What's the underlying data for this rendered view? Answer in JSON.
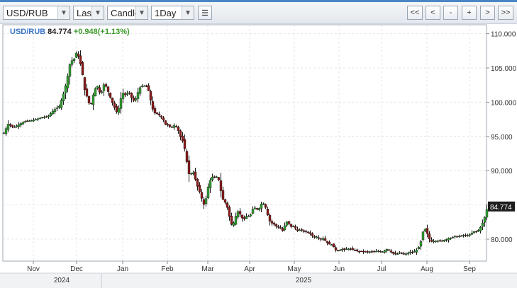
{
  "toolbar": {
    "symbol": "USD/RUB",
    "price_field": "Last",
    "chart_style": "Candle",
    "interval": "1Day",
    "buttons": [
      "<<",
      "<",
      "-",
      "+",
      ">",
      ">>"
    ],
    "menu_icon": "list-icon"
  },
  "legend": {
    "symbol": "USD/RUB",
    "last": "84.774",
    "change": "+0.948(+1.13%)"
  },
  "colors": {
    "up": "#2e9e2e",
    "down": "#8b1a1a",
    "grid": "#e4e4e4",
    "accent": "#4a86c5"
  },
  "chart_data": {
    "type": "candlestick",
    "title": "USD/RUB",
    "price_tag": "84.774",
    "y_ticks": [
      "80.000",
      "85.000",
      "90.000",
      "95.000",
      "100.000",
      "105.000",
      "110.000"
    ],
    "ylim": [
      76.8,
      111.3
    ],
    "x_ticks": [
      "Nov",
      "Dec",
      "Jan",
      "Feb",
      "Mar",
      "Apr",
      "May",
      "Jun",
      "Jul",
      "Aug",
      "Sep"
    ],
    "year_labels": [
      "2024",
      "2025"
    ],
    "grid": true,
    "close_path": [
      [
        0,
        95.5
      ],
      [
        6,
        96.8
      ],
      [
        14,
        96.3
      ],
      [
        22,
        96.8
      ],
      [
        30,
        97.2
      ],
      [
        38,
        97.3
      ],
      [
        46,
        97.5
      ],
      [
        54,
        97.8
      ],
      [
        62,
        97.9
      ],
      [
        70,
        98.8
      ],
      [
        78,
        99.4
      ],
      [
        84,
        101.2
      ],
      [
        88,
        102.8
      ],
      [
        92,
        104.8
      ],
      [
        94,
        106.2
      ],
      [
        97,
        106.0
      ],
      [
        100,
        106.5
      ],
      [
        103,
        107.5
      ],
      [
        106,
        106.3
      ],
      [
        109,
        105.2
      ],
      [
        112,
        103.4
      ],
      [
        115,
        101.0
      ],
      [
        118,
        100.8
      ],
      [
        121,
        99.4
      ],
      [
        124,
        100.0
      ],
      [
        127,
        101.6
      ],
      [
        130,
        102.2
      ],
      [
        133,
        102.4
      ],
      [
        136,
        101.0
      ],
      [
        139,
        101.8
      ],
      [
        142,
        102.9
      ],
      [
        145,
        102.0
      ],
      [
        148,
        101.3
      ],
      [
        151,
        100.4
      ],
      [
        154,
        99.7
      ],
      [
        157,
        99.0
      ],
      [
        160,
        98.4
      ],
      [
        163,
        99.4
      ],
      [
        166,
        101.1
      ],
      [
        169,
        101.4
      ],
      [
        172,
        100.9
      ],
      [
        175,
        101.5
      ],
      [
        178,
        101.3
      ],
      [
        181,
        100.3
      ],
      [
        184,
        100.2
      ],
      [
        187,
        100.7
      ],
      [
        190,
        101.8
      ],
      [
        193,
        102.3
      ],
      [
        196,
        102.4
      ],
      [
        199,
        102.4
      ],
      [
        202,
        102.2
      ],
      [
        205,
        101.4
      ],
      [
        208,
        99.7
      ],
      [
        211,
        98.6
      ],
      [
        214,
        98.3
      ],
      [
        217,
        98.3
      ],
      [
        220,
        98.0
      ],
      [
        223,
        97.7
      ],
      [
        226,
        97.2
      ],
      [
        229,
        96.5
      ],
      [
        232,
        96.7
      ],
      [
        235,
        96.3
      ],
      [
        238,
        96.4
      ],
      [
        241,
        96.7
      ],
      [
        244,
        96.3
      ],
      [
        247,
        95.6
      ],
      [
        250,
        94.6
      ],
      [
        253,
        94.2
      ],
      [
        256,
        92.7
      ],
      [
        259,
        90.6
      ],
      [
        262,
        89.0
      ],
      [
        265,
        89.9
      ],
      [
        268,
        89.6
      ],
      [
        271,
        88.3
      ],
      [
        274,
        87.4
      ],
      [
        277,
        86.7
      ],
      [
        280,
        85.6
      ],
      [
        283,
        84.8
      ],
      [
        286,
        86.5
      ],
      [
        289,
        88.2
      ],
      [
        292,
        88.8
      ],
      [
        295,
        89.2
      ],
      [
        298,
        88.9
      ],
      [
        301,
        89.2
      ],
      [
        304,
        88.4
      ],
      [
        307,
        86.4
      ],
      [
        310,
        85.5
      ],
      [
        313,
        85.3
      ],
      [
        316,
        84.3
      ],
      [
        319,
        82.8
      ],
      [
        322,
        81.8
      ],
      [
        325,
        82.7
      ],
      [
        328,
        83.7
      ],
      [
        331,
        84.2
      ],
      [
        334,
        83.4
      ],
      [
        337,
        82.9
      ],
      [
        340,
        83.0
      ],
      [
        343,
        83.5
      ],
      [
        346,
        83.3
      ],
      [
        349,
        83.7
      ],
      [
        352,
        84.7
      ],
      [
        355,
        84.5
      ],
      [
        358,
        84.3
      ],
      [
        361,
        84.6
      ],
      [
        364,
        85.4
      ],
      [
        367,
        85.1
      ],
      [
        370,
        84.4
      ],
      [
        373,
        83.1
      ],
      [
        376,
        82.4
      ],
      [
        379,
        82.3
      ],
      [
        382,
        82.1
      ],
      [
        385,
        81.8
      ],
      [
        388,
        81.7
      ],
      [
        391,
        81.5
      ],
      [
        394,
        81.1
      ],
      [
        397,
        82.4
      ],
      [
        400,
        82.6
      ],
      [
        403,
        82.1
      ],
      [
        406,
        81.7
      ],
      [
        409,
        82.0
      ],
      [
        412,
        81.4
      ],
      [
        415,
        81.2
      ],
      [
        418,
        81.4
      ],
      [
        421,
        81.3
      ],
      [
        424,
        81.0
      ],
      [
        427,
        81.1
      ],
      [
        430,
        81.0
      ],
      [
        433,
        80.7
      ],
      [
        436,
        80.4
      ],
      [
        439,
        80.2
      ],
      [
        442,
        80.4
      ],
      [
        445,
        80.0
      ],
      [
        448,
        80.0
      ],
      [
        451,
        80.2
      ],
      [
        454,
        79.6
      ],
      [
        457,
        79.4
      ],
      [
        460,
        79.2
      ],
      [
        463,
        79.2
      ],
      [
        466,
        78.7
      ],
      [
        469,
        78.3
      ],
      [
        472,
        78.4
      ],
      [
        475,
        78.4
      ],
      [
        478,
        78.6
      ],
      [
        481,
        78.4
      ],
      [
        484,
        78.7
      ],
      [
        487,
        78.5
      ],
      [
        490,
        78.6
      ],
      [
        493,
        78.4
      ],
      [
        496,
        78.4
      ],
      [
        499,
        78.2
      ],
      [
        502,
        78.2
      ],
      [
        505,
        78.3
      ],
      [
        508,
        78.1
      ],
      [
        511,
        78.2
      ],
      [
        514,
        78.1
      ],
      [
        517,
        78.2
      ],
      [
        520,
        78.2
      ],
      [
        523,
        78.1
      ],
      [
        526,
        78.3
      ],
      [
        529,
        78.3
      ],
      [
        532,
        78.1
      ],
      [
        535,
        78.2
      ],
      [
        538,
        78.4
      ],
      [
        541,
        78.6
      ],
      [
        544,
        78.3
      ],
      [
        547,
        78.0
      ],
      [
        550,
        77.9
      ],
      [
        553,
        77.8
      ],
      [
        556,
        77.9
      ],
      [
        559,
        78.1
      ],
      [
        562,
        77.8
      ],
      [
        565,
        77.8
      ],
      [
        568,
        77.9
      ],
      [
        571,
        78.0
      ],
      [
        574,
        78.2
      ],
      [
        577,
        78.0
      ],
      [
        580,
        78.3
      ],
      [
        583,
        78.5
      ],
      [
        586,
        79.0
      ],
      [
        589,
        80.0
      ],
      [
        592,
        81.6
      ],
      [
        595,
        81.4
      ],
      [
        598,
        80.5
      ],
      [
        601,
        79.8
      ],
      [
        604,
        79.6
      ],
      [
        607,
        79.8
      ],
      [
        610,
        79.7
      ],
      [
        613,
        79.8
      ],
      [
        616,
        79.7
      ],
      [
        619,
        79.8
      ],
      [
        622,
        79.9
      ],
      [
        625,
        80.0
      ],
      [
        628,
        80.2
      ],
      [
        631,
        80.1
      ],
      [
        634,
        80.4
      ],
      [
        637,
        80.5
      ],
      [
        640,
        80.3
      ],
      [
        643,
        80.5
      ],
      [
        646,
        80.5
      ],
      [
        649,
        80.6
      ],
      [
        652,
        80.5
      ],
      [
        655,
        80.6
      ],
      [
        658,
        80.7
      ],
      [
        661,
        81.0
      ],
      [
        664,
        81.2
      ],
      [
        667,
        81.1
      ],
      [
        670,
        81.4
      ],
      [
        673,
        81.9
      ],
      [
        676,
        82.6
      ],
      [
        679,
        83.5
      ],
      [
        682,
        84.77
      ]
    ]
  }
}
